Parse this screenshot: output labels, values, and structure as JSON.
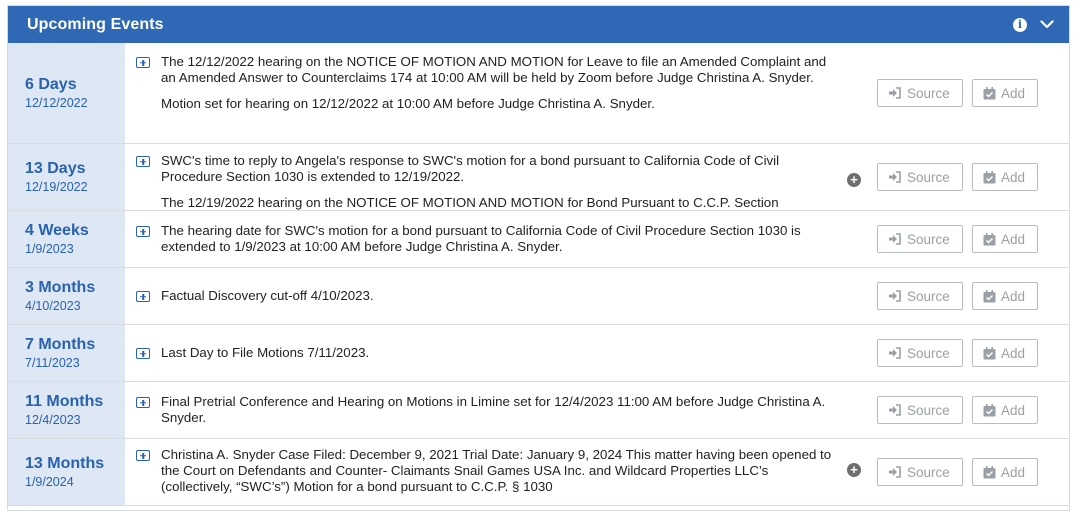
{
  "header": {
    "title": "Upcoming Events"
  },
  "buttons": {
    "source_label": "Source",
    "add_label": "Add"
  },
  "events": [
    {
      "relative": "6 Days",
      "date": "12/12/2022",
      "paragraphs": [
        "The 12/12/2022 hearing on the NOTICE OF MOTION AND MOTION for Leave to file an Amended Complaint and an Amended Answer to Counterclaims 174 at 10:00 AM will be held by Zoom before Judge Christina A. Snyder.",
        "Motion set for hearing on 12/12/2022 at 10:00 AM before Judge Christina A. Snyder."
      ],
      "has_more": false
    },
    {
      "relative": "13 Days",
      "date": "12/19/2022",
      "paragraphs": [
        "SWC's time to reply to Angela's response to SWC's motion for a bond pursuant to California Code of Civil Procedure Section 1030 is extended to 12/19/2022.",
        "The 12/19/2022 hearing on the NOTICE OF MOTION AND MOTION for Bond Pursuant to C.C.P. Section"
      ],
      "has_more": true
    },
    {
      "relative": "4 Weeks",
      "date": "1/9/2023",
      "paragraphs": [
        "The hearing date for SWC's motion for a bond pursuant to California Code of Civil Procedure Section 1030 is extended to 1/9/2023 at 10:00 AM before Judge Christina A. Snyder."
      ],
      "has_more": false
    },
    {
      "relative": "3 Months",
      "date": "4/10/2023",
      "paragraphs": [
        "Factual Discovery cut-off 4/10/2023."
      ],
      "has_more": false
    },
    {
      "relative": "7 Months",
      "date": "7/11/2023",
      "paragraphs": [
        "Last Day to File Motions 7/11/2023."
      ],
      "has_more": false
    },
    {
      "relative": "11 Months",
      "date": "12/4/2023",
      "paragraphs": [
        "Final Pretrial Conference and Hearing on Motions in Limine set for 12/4/2023 11:00 AM before Judge Christina A. Snyder."
      ],
      "has_more": false
    },
    {
      "relative": "13 Months",
      "date": "1/9/2024",
      "paragraphs": [
        "Christina A. Snyder Case Filed: December 9, 2021 Trial Date: January 9, 2024 This matter having been opened to the Court on Defendants and Counter- Claimants Snail Games USA Inc. and Wildcard Properties LLC’s (collectively, “SWC’s”) Motion for a bond pursuant to C.C.P. § 1030"
      ],
      "has_more": true
    }
  ]
}
